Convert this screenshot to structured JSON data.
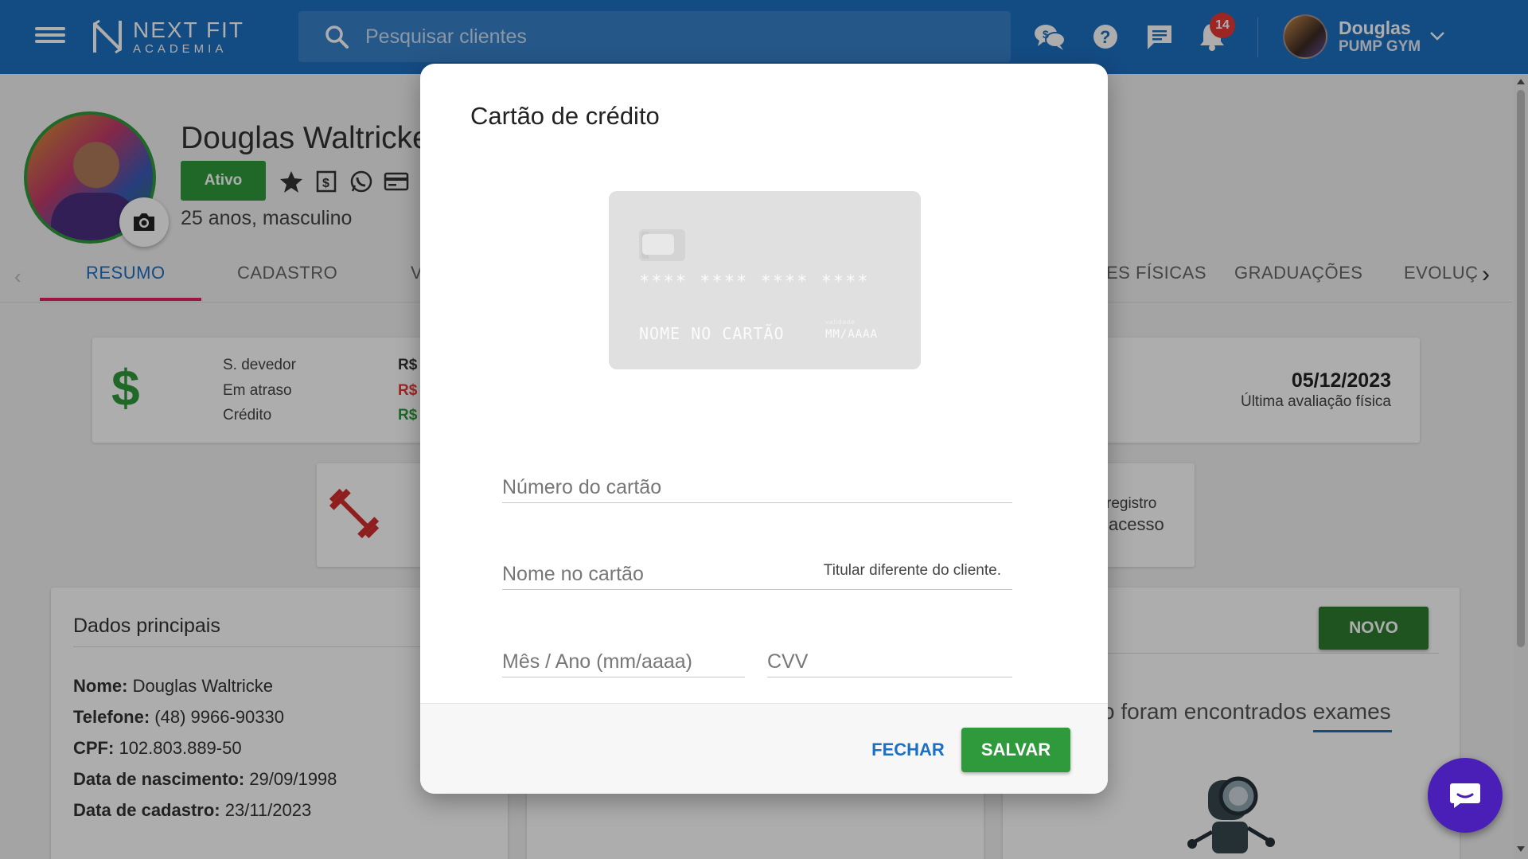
{
  "header": {
    "logo_main": "NEXT FIT",
    "logo_sub": "ACADEMIA",
    "search_placeholder": "Pesquisar clientes",
    "notification_count": "14",
    "user_name": "Douglas",
    "user_gym": "PUMP GYM"
  },
  "profile": {
    "name": "Douglas Waltricke",
    "status": "Ativo",
    "age_gender": "25 anos, masculino"
  },
  "tabs": {
    "resumo": "RESUMO",
    "cadastro": "CADASTRO",
    "partial_v": "V",
    "fisicas": "ES FÍSICAS",
    "graduacoes": "GRADUAÇÕES",
    "evolucao": "EVOLUÇ"
  },
  "finance": {
    "label_debtor": "S. devedor",
    "label_overdue": "Em atraso",
    "label_credit": "Crédito",
    "value_prefix": "R$",
    "last_eval_date": "05/12/2023",
    "last_eval_label": "Última avaliação física"
  },
  "access": {
    "line1": "registro",
    "line2": "acesso"
  },
  "main_data": {
    "title": "Dados principais",
    "name_label": "Nome:",
    "name_value": "Douglas Waltricke",
    "phone_label": "Telefone:",
    "phone_value": "(48) 9966-90330",
    "cpf_label": "CPF:",
    "cpf_value": "102.803.889-50",
    "birth_label": "Data de nascimento:",
    "birth_value": "29/09/1998",
    "signup_label": "Data de cadastro:",
    "signup_value": "23/11/2023"
  },
  "exams": {
    "new_button": "NOVO",
    "empty_text_prefix": "o foram encontrados ",
    "empty_text_link": "exames"
  },
  "modal": {
    "title": "Cartão de crédito",
    "card_preview": {
      "number": "**** **** **** ****",
      "holder": "NOME NO CARTÃO",
      "valid_label": "validade",
      "expiry": "MM/AAAA"
    },
    "fields": {
      "number_placeholder": "Número do cartão",
      "holder_placeholder": "Nome no cartão",
      "holder_note": "Titular diferente do cliente.",
      "expiry_placeholder": "Mês / Ano (mm/aaaa)",
      "cvv_placeholder": "CVV"
    },
    "buttons": {
      "close": "FECHAR",
      "save": "SALVAR"
    }
  },
  "colors": {
    "primary": "#1c6fc2",
    "success": "#2e9a3c",
    "danger": "#e53935",
    "accent_tab": "#e91e63",
    "chat": "#4a1fb8"
  }
}
